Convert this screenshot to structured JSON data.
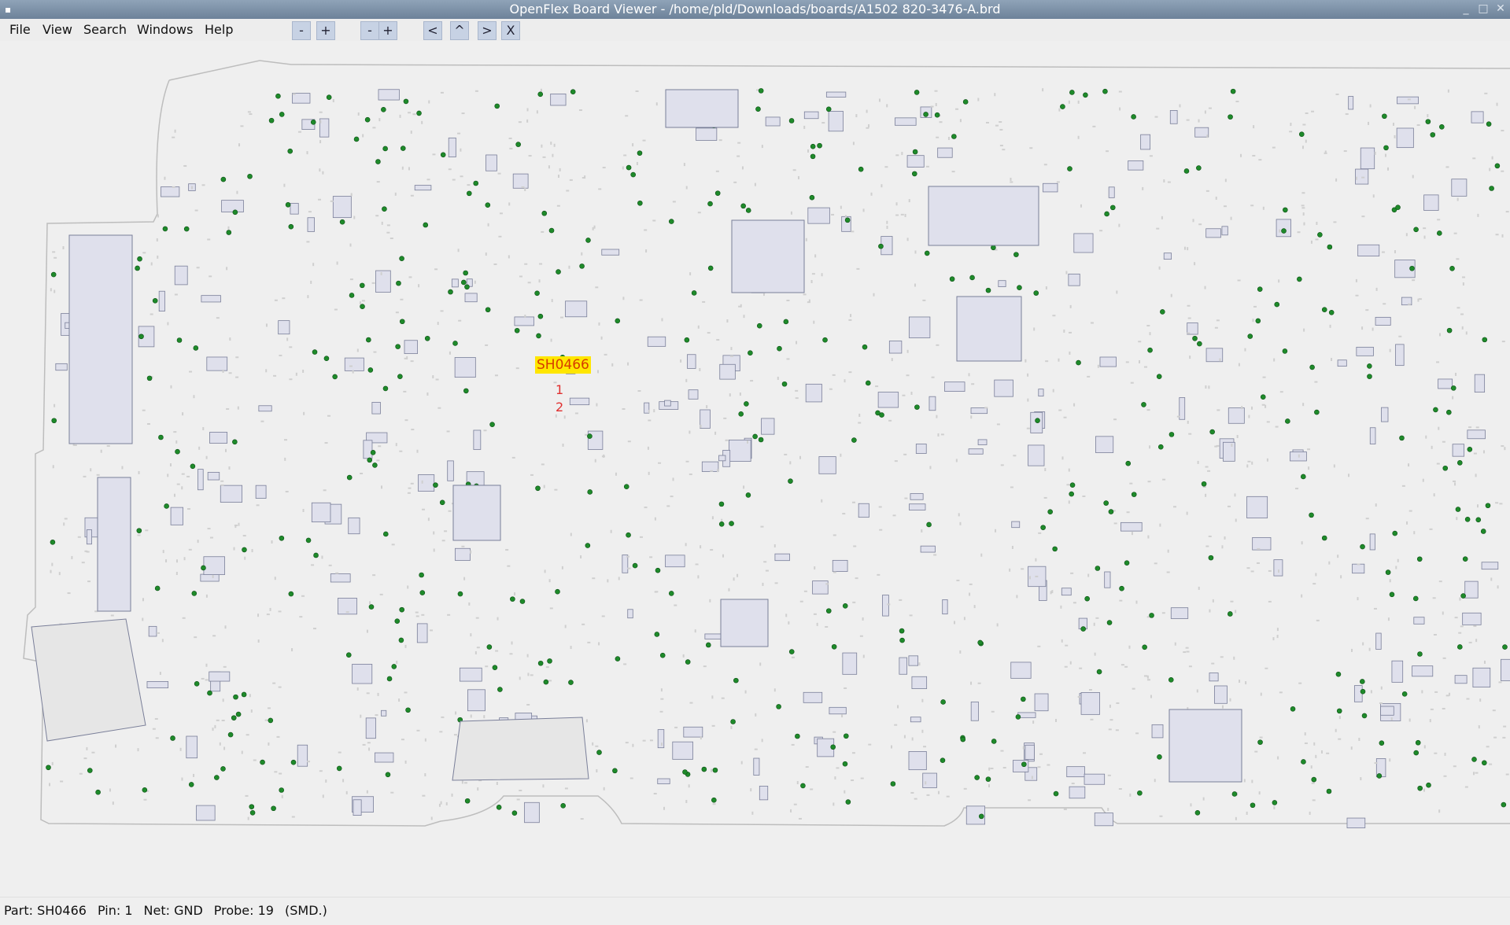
{
  "window": {
    "title": "OpenFlex Board Viewer - /home/pld/Downloads/boards/A1502 820-3476-A.brd",
    "controls": [
      "minimize-icon",
      "maximize-icon",
      "close-icon"
    ]
  },
  "menu": {
    "items": [
      "File",
      "View",
      "Search",
      "Windows",
      "Help"
    ]
  },
  "toolbar": {
    "zoom_out_1": "-",
    "zoom_in_1": "+",
    "zoom_out_2": "-",
    "zoom_in_2": "+",
    "pan_left": "<",
    "pan_up": "^",
    "pan_right": ">",
    "close": "X"
  },
  "board": {
    "selected_part": "SH0466",
    "pins": [
      "1",
      "2"
    ],
    "colors": {
      "outline": "#bdbdbd",
      "part_outline": "#7a7f99",
      "part_fill": "#dfe0ec",
      "pad": "#cfcfcf",
      "probe": "#1e8a2a",
      "highlight_bg": "#ffe600",
      "highlight_text": "#d63b00",
      "pin_text": "#e03030"
    }
  },
  "status": {
    "part": "Part: SH0466",
    "pin": "Pin: 1",
    "net": "Net: GND",
    "probe": "Probe: 19",
    "mount": "(SMD.)"
  }
}
